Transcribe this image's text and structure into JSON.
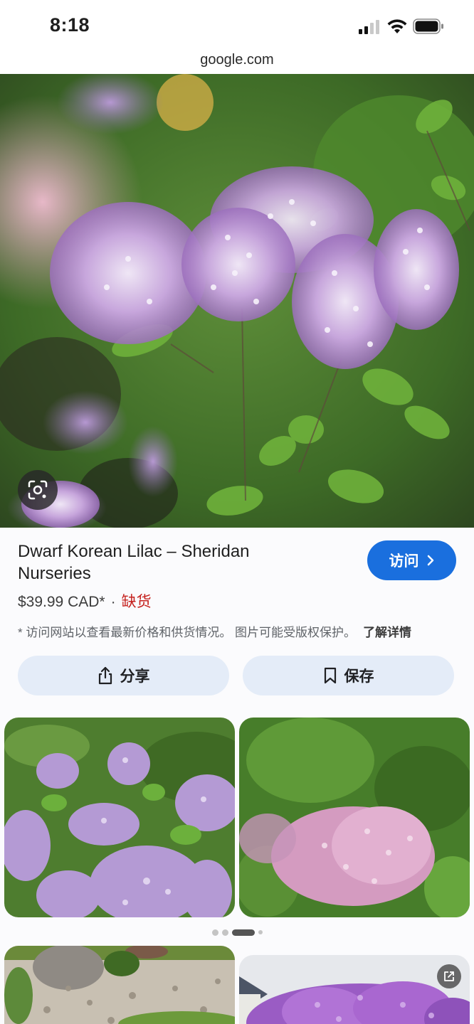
{
  "status_bar": {
    "time": "8:18"
  },
  "browser": {
    "url": "google.com"
  },
  "result": {
    "title": "Dwarf Korean Lilac – Sheridan Nurseries",
    "visit_label": "访问",
    "price": "$39.99 CAD*",
    "separator": "·",
    "stock_status": "缺货",
    "stock_color": "#c5221f",
    "note": "* 访问网站以查看最新价格和供货情况。 图片可能受版权保护。",
    "learn_more": "了解详情",
    "share_label": "分享",
    "save_label": "保存"
  },
  "related": {
    "carousel_pages": 4,
    "active_page": 3
  },
  "colors": {
    "accent": "#1a6fde",
    "pill_bg": "#e4ecf8"
  },
  "icons": [
    "signal-icon",
    "wifi-icon",
    "battery-icon",
    "lens-icon",
    "chevron-right-icon",
    "share-icon",
    "bookmark-icon",
    "open-external-icon"
  ]
}
